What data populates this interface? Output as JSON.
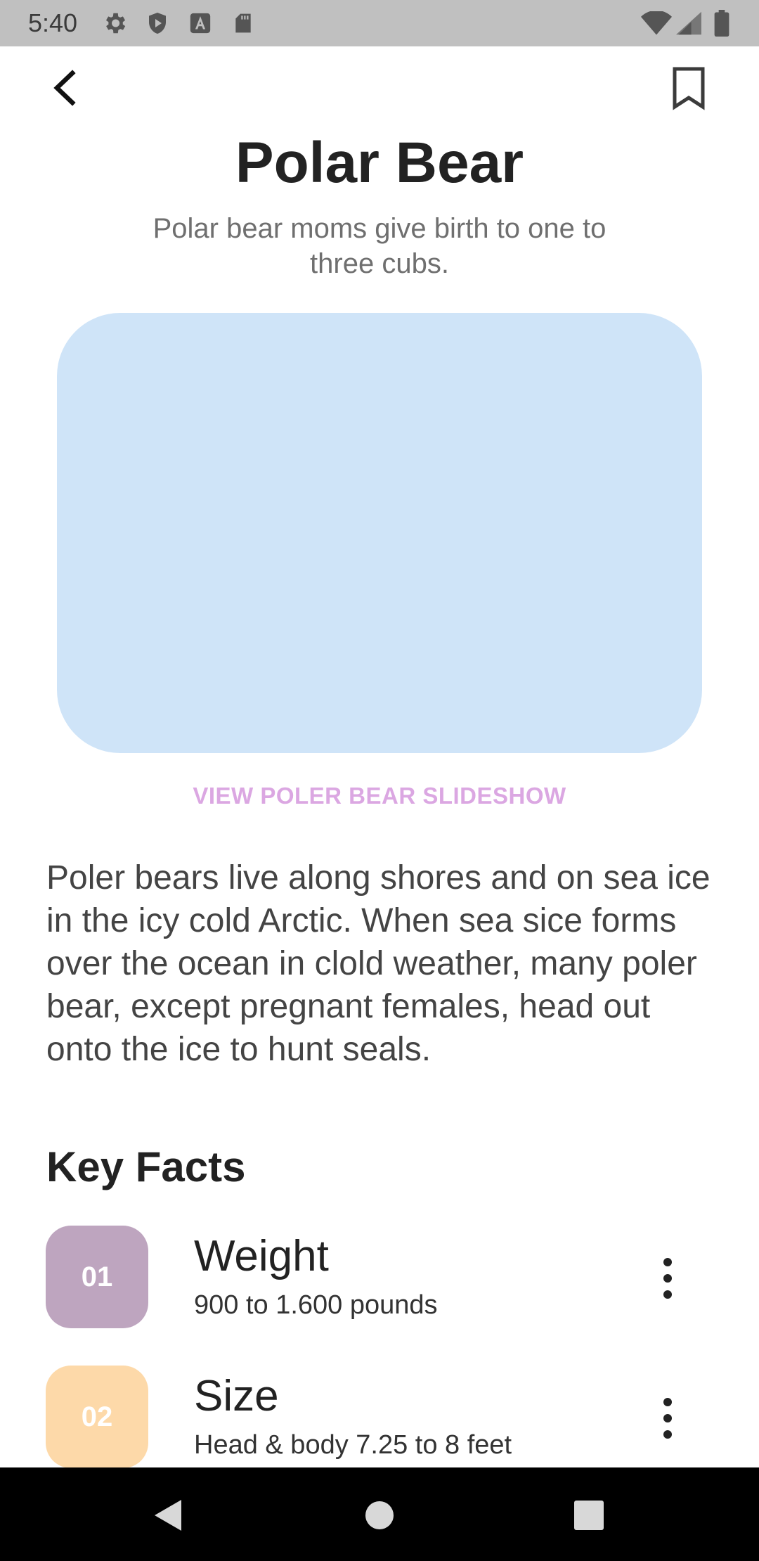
{
  "status_bar": {
    "time": "5:40",
    "icons": [
      "gear-icon",
      "shield-play-icon",
      "font-a-icon",
      "sd-card-icon",
      "wifi-icon",
      "signal-icon",
      "battery-icon"
    ]
  },
  "app_bar": {
    "back_icon": "chevron-left-icon",
    "bookmark_icon": "bookmark-icon"
  },
  "header": {
    "title": "Polar Bear",
    "subtitle": "Polar bear moms give birth to one to three cubs."
  },
  "media": {
    "placeholder_color": "#cfe4f8",
    "slideshow_label": "VIEW POLER BEAR SLIDESHOW"
  },
  "description": "Poler bears live along shores and on sea ice in the icy cold Arctic. When sea sice forms over the ocean in clold weather, many poler bear, except pregnant females, head out onto the ice to hunt seals.",
  "key_facts": {
    "heading": "Key Facts",
    "items": [
      {
        "number": "01",
        "title": "Weight",
        "value": "900 to 1.600 pounds",
        "badge_color": "#bea5bf"
      },
      {
        "number": "02",
        "title": "Size",
        "value": "Head & body 7.25 to 8 feet",
        "badge_color": "#fdd9a9"
      }
    ]
  },
  "nav_bar": {
    "buttons": [
      "back-triangle-icon",
      "home-circle-icon",
      "recents-square-icon"
    ]
  }
}
